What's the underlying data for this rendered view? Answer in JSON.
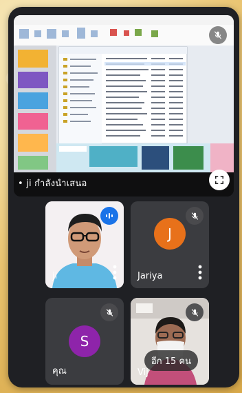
{
  "presentation": {
    "caption": "• ji กำลังนำเสนอ"
  },
  "participants": [
    {
      "name": "ji",
      "avatar_letter": "",
      "muted": false,
      "speaking": true
    },
    {
      "name": "Jariya",
      "avatar_letter": "J",
      "avatar_color": "#e8711a",
      "muted": true
    },
    {
      "name": "คุณ",
      "avatar_letter": "S",
      "avatar_color": "#8e24aa",
      "muted": true
    },
    {
      "name": "Vij",
      "avatar_letter": "",
      "muted": true
    }
  ],
  "overflow": {
    "label": "อีก 15 คน"
  },
  "colors": {
    "tile_bg": "#3b3c40",
    "app_bg": "#1f2024",
    "speaking_blue": "#1a73e8"
  }
}
